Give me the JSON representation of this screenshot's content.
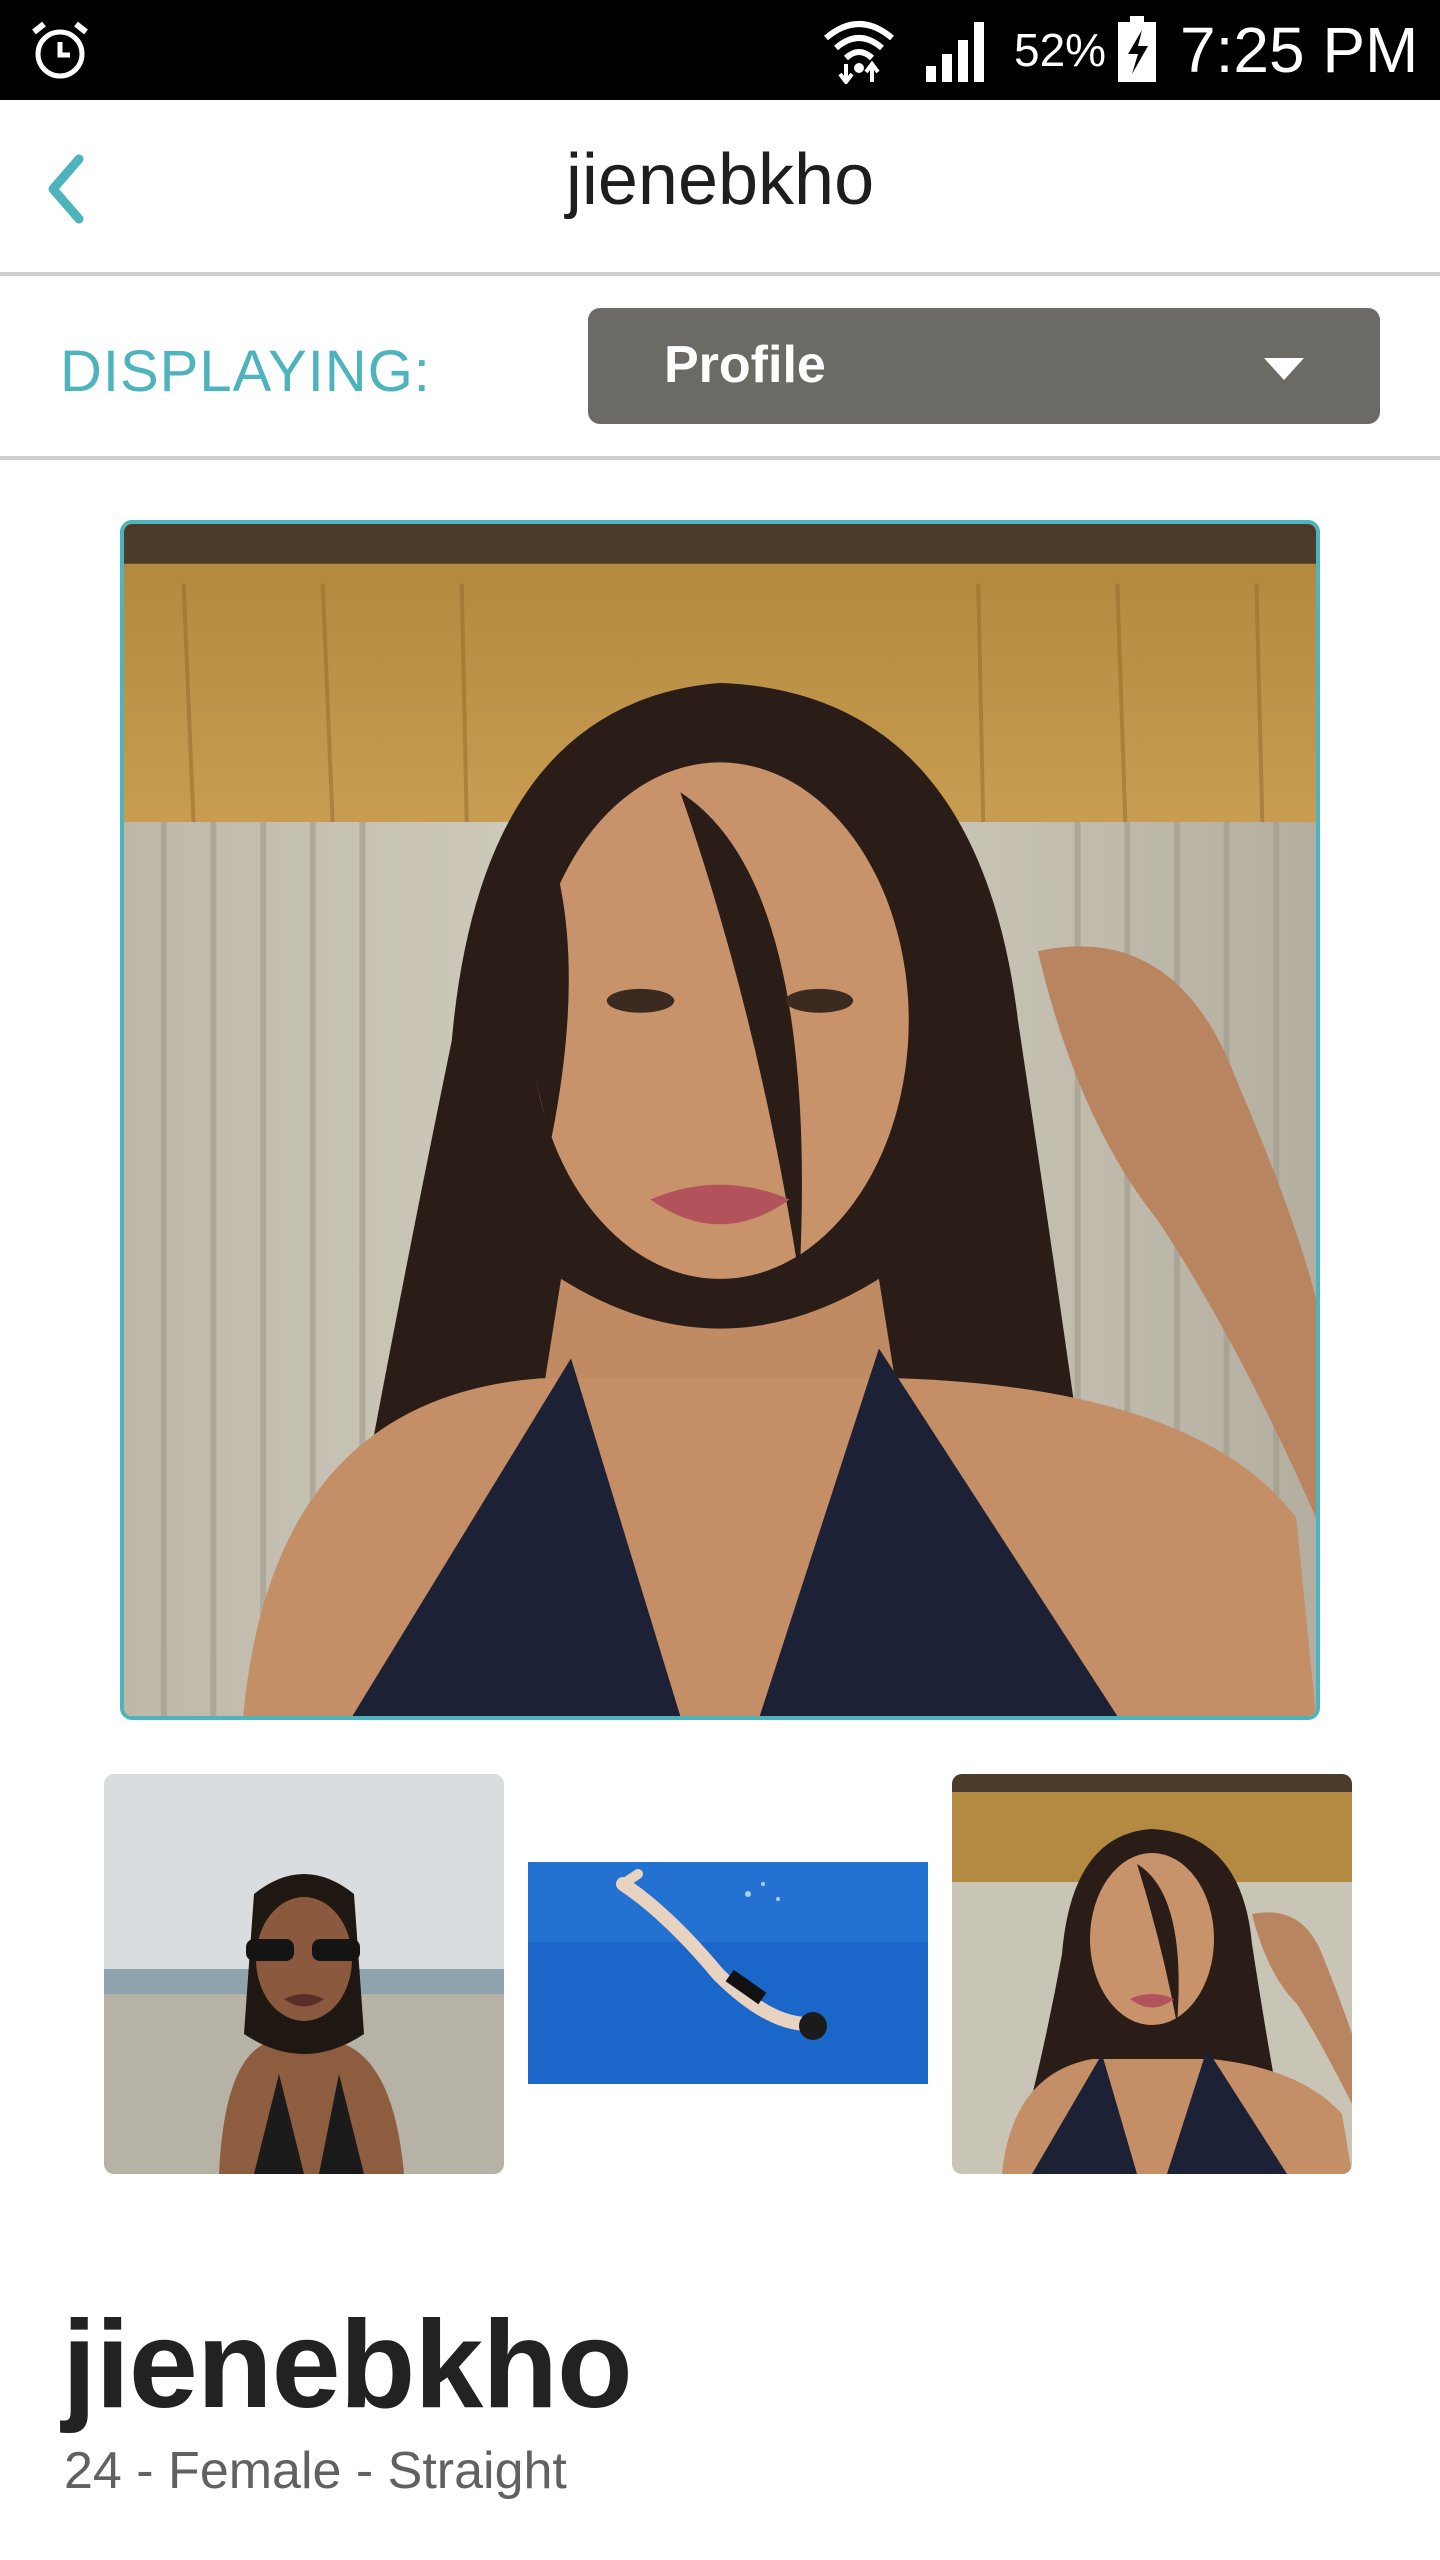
{
  "status_bar": {
    "battery_percent": "52%",
    "time": "7:25 PM",
    "icons": [
      "alarm-icon",
      "wifi-icon",
      "signal-icon",
      "battery-charging-icon"
    ]
  },
  "header": {
    "title": "jienebkho",
    "back_icon": "chevron-left-icon"
  },
  "display_filter": {
    "label": "DISPLAYING:",
    "selected": "Profile"
  },
  "photos": {
    "main": "profile-photo",
    "thumbnails": [
      "thumbnail-beach",
      "thumbnail-underwater",
      "thumbnail-portrait"
    ]
  },
  "profile": {
    "username": "jienebkho",
    "details": "24 - Female - Straight"
  },
  "colors": {
    "accent": "#4db3bd",
    "dropdown_bg": "#6b6a65",
    "status_bar_bg": "#000000"
  }
}
